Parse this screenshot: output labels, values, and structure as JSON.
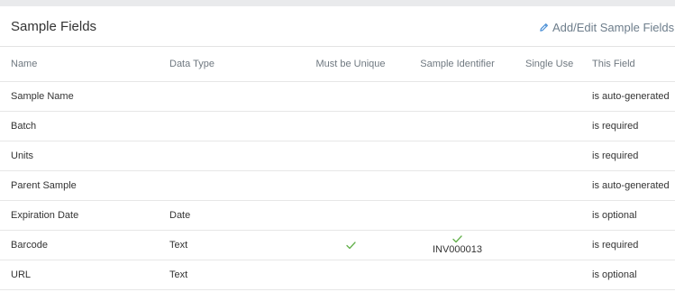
{
  "panel": {
    "title": "Sample Fields",
    "action_label": "Add/Edit Sample Fields",
    "accent_color": "#4a8fd6",
    "check_color": "#62b04a"
  },
  "columns": [
    "Name",
    "Data Type",
    "Must be Unique",
    "Sample Identifier",
    "Single Use",
    "This Field"
  ],
  "rows": [
    {
      "name": "Sample Name",
      "type": "",
      "unique": false,
      "identifier": false,
      "identifier_value": "",
      "single_use": "",
      "field": "is auto-generated"
    },
    {
      "name": "Batch",
      "type": "",
      "unique": false,
      "identifier": false,
      "identifier_value": "",
      "single_use": "",
      "field": "is required"
    },
    {
      "name": "Units",
      "type": "",
      "unique": false,
      "identifier": false,
      "identifier_value": "",
      "single_use": "",
      "field": "is required"
    },
    {
      "name": "Parent Sample",
      "type": "",
      "unique": false,
      "identifier": false,
      "identifier_value": "",
      "single_use": "",
      "field": "is auto-generated"
    },
    {
      "name": "Expiration Date",
      "type": "Date",
      "unique": false,
      "identifier": false,
      "identifier_value": "",
      "single_use": "",
      "field": "is optional"
    },
    {
      "name": "Barcode",
      "type": "Text",
      "unique": true,
      "identifier": true,
      "identifier_value": "INV000013",
      "single_use": "",
      "field": "is required"
    },
    {
      "name": "URL",
      "type": "Text",
      "unique": false,
      "identifier": false,
      "identifier_value": "",
      "single_use": "",
      "field": "is optional"
    }
  ]
}
